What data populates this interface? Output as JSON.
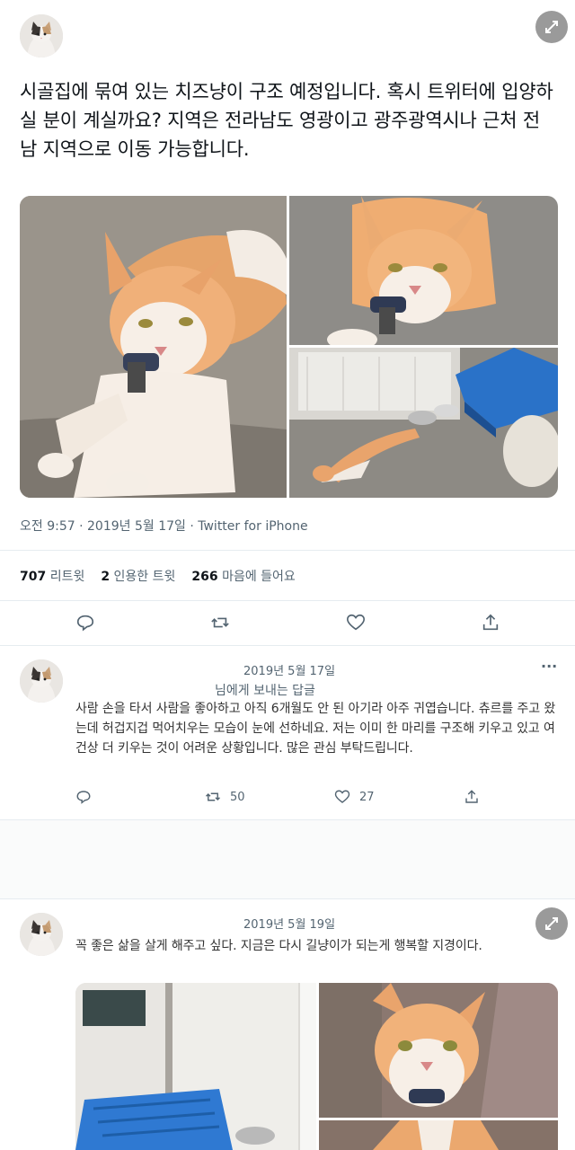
{
  "main_tweet": {
    "avatar_alt": "calico-cat-avatar",
    "text": "시골집에 묶여 있는 치즈냥이 구조 예정입니다. 혹시 트위터에 입양하실 분이 계실까요? 지역은 전라남도 영광이고 광주광역시나 근처 전남 지역으로 이동 가능합니다.",
    "timestamp": "오전 9:57 · 2019년 5월 17일 · Twitter for iPhone",
    "stats": {
      "retweets_count": "707",
      "retweets_label": "리트윗",
      "quotes_count": "2",
      "quotes_label": "인용한 트윗",
      "likes_count": "266",
      "likes_label": "마음에 들어요"
    }
  },
  "reply_1": {
    "date": "2019년 5월 17일",
    "reply_context": "님에게 보내는 답글",
    "text": "사람 손을 타서 사람을 좋아하고 아직 6개월도 안 된 아기라 아주 귀엽습니다. 츄르를 주고 왔는데 허겁지겁 먹어치우는 모습이 눈에 선하네요. 저는 이미 한 마리를 구조해 키우고 있고 여건상 더 키우는 것이 어려운 상황입니다. 많은 관심 부탁드립니다.",
    "retweets": "50",
    "likes": "27",
    "more": "···"
  },
  "reply_2": {
    "date": "2019년 5월 19일",
    "text": "꼭 좋은 삶을 살게 해주고 싶다. 지금은 다시 길냥이가 되는게 행복할 지경이다."
  },
  "colors": {
    "text_primary": "#0f1419",
    "text_secondary": "#536471",
    "divider": "#e6ecf0"
  }
}
